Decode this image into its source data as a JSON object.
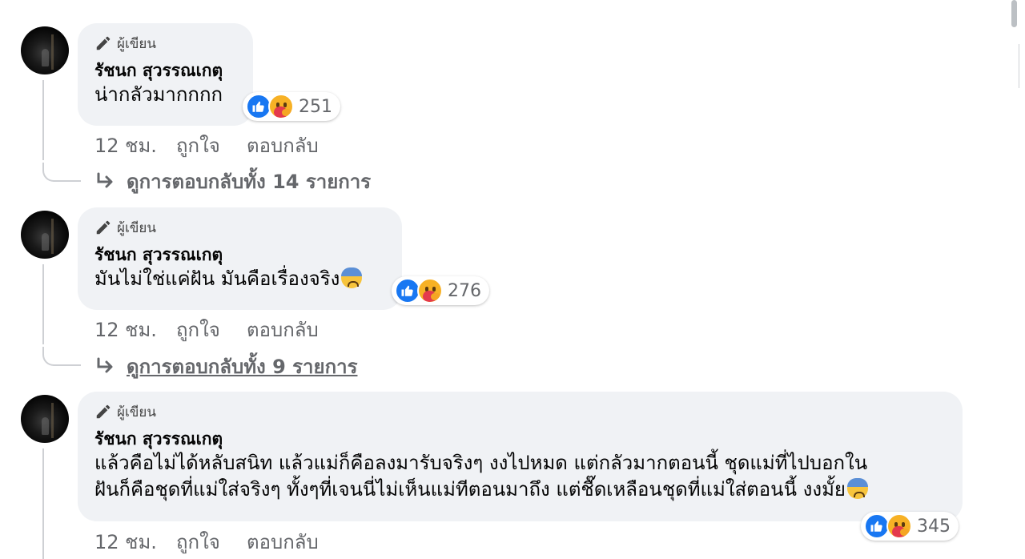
{
  "comments": [
    {
      "badge": "ผู้เขียน",
      "author": "รัชนก สุวรรณเกตุ",
      "lines": [
        "น่ากลัวมากกกก"
      ],
      "reaction_count": "251",
      "time": "12 ชม.",
      "like_label": "ถูกใจ",
      "reply_label": "ตอบกลับ",
      "view_replies": "ดูการตอบกลับทั้ง 14 รายการ"
    },
    {
      "badge": "ผู้เขียน",
      "author": "รัชนก สุวรรณเกตุ",
      "lines": [
        "มันไม่ใช่แค่ฝัน มันคือเรื่องจริง"
      ],
      "reaction_count": "276",
      "time": "12 ชม.",
      "like_label": "ถูกใจ",
      "reply_label": "ตอบกลับ",
      "view_replies": "ดูการตอบกลับทั้ง 9 รายการ"
    },
    {
      "badge": "ผู้เขียน",
      "author": "รัชนก สุวรรณเกตุ",
      "lines": [
        "แล้วคือไม่ได้หลับสนิท แล้วแม่ก็คือลงมารับจริงๆ งงไปหมด แต่กลัวมากตอนนี้ ชุดแม่ที่ไปบอกใน",
        "ฝันก็คือชุดที่แม่ใส่จริงๆ ทั้งๆที่เจนนี่ไม่เห็นแม่ทีตอนมาถึง แต่ชื๊ดเหลือนชุดที่แม่ใส่ตอนนี้ งงมั้ย"
      ],
      "reaction_count": "345",
      "time": "12 ชม.",
      "like_label": "ถูกใจ",
      "reply_label": "ตอบกลับ"
    }
  ],
  "icons": {
    "badge": "pencil-icon",
    "reply_arrow": "reply-arrow-icon",
    "reaction_like": "like-reaction-icon",
    "reaction_care": "care-reaction-icon",
    "emoji": "anxious-sweat-emoji"
  },
  "colors": {
    "bubble": "#f0f2f5",
    "meta_text": "#65676b",
    "like_blue": "#1877f2",
    "thread_line": "#ced0d4"
  }
}
